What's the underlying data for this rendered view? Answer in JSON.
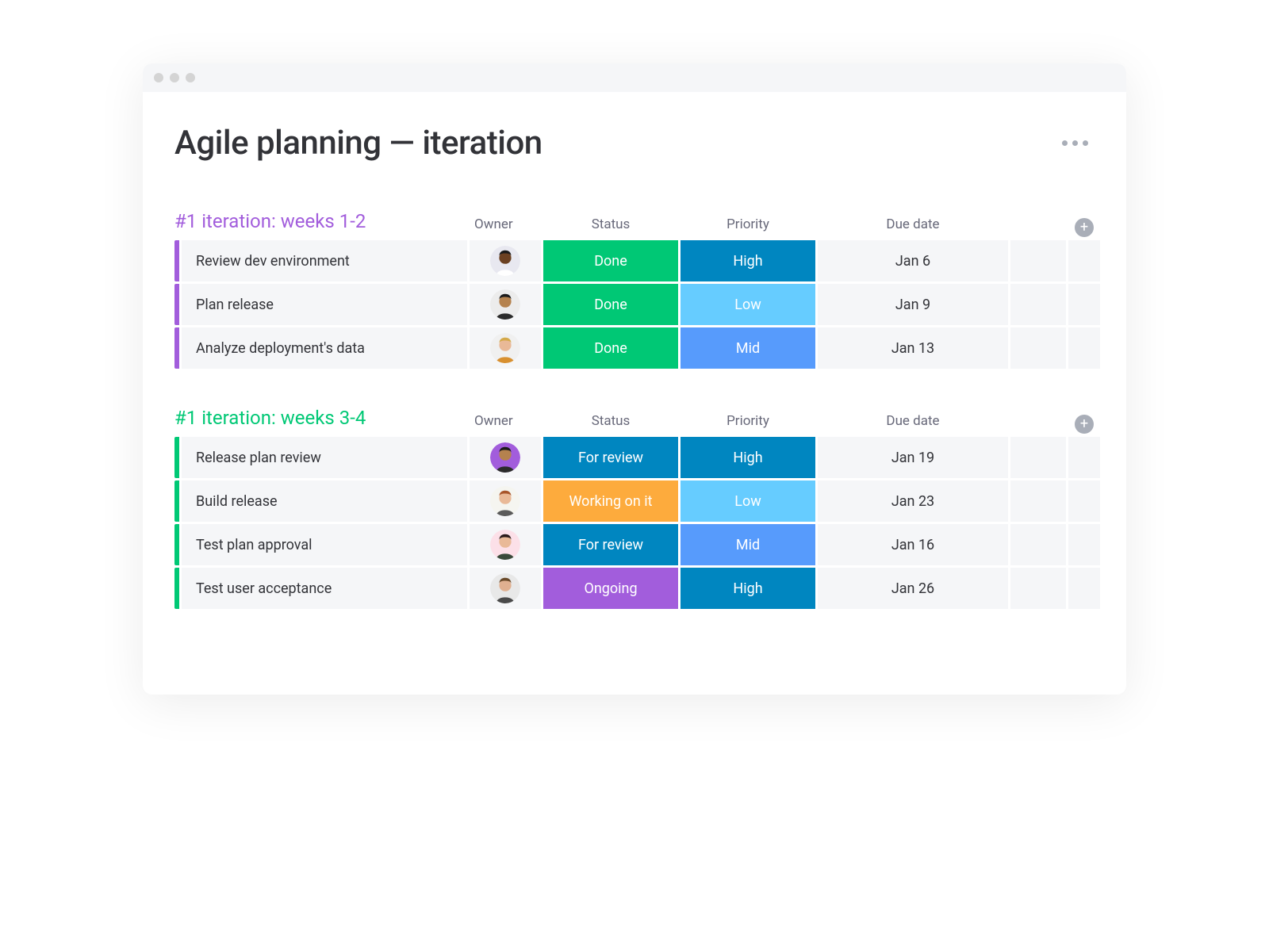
{
  "page": {
    "title": "Agile planning — iteration"
  },
  "columns": {
    "owner": "Owner",
    "status": "Status",
    "priority": "Priority",
    "due_date": "Due date"
  },
  "colors": {
    "purple_accent": "#a25ddc",
    "green_accent": "#00c875",
    "status_done": "#00c875",
    "status_for_review": "#0086c0",
    "status_working": "#fdab3d",
    "status_ongoing": "#a25ddc",
    "priority_high": "#0086c0",
    "priority_mid": "#579bfc",
    "priority_low": "#66ccff"
  },
  "groups": [
    {
      "title": "#1 iteration: weeks 1-2",
      "accent_color": "#a25ddc",
      "rows": [
        {
          "task": "Review dev environment",
          "owner_avatar": {
            "skin": "#6b4021",
            "bg": "#e8e8f0",
            "shirt": "#ffffff",
            "hair": "#1a1a1a"
          },
          "status": {
            "label": "Done",
            "color_key": "status_done"
          },
          "priority": {
            "label": "High",
            "color_key": "priority_high"
          },
          "due_date": "Jan 6"
        },
        {
          "task": "Plan release",
          "owner_avatar": {
            "skin": "#b5824e",
            "bg": "#ececec",
            "shirt": "#2b2b2b",
            "hair": "#1a1a1a"
          },
          "status": {
            "label": "Done",
            "color_key": "status_done"
          },
          "priority": {
            "label": "Low",
            "color_key": "priority_low"
          },
          "due_date": "Jan 9"
        },
        {
          "task": "Analyze deployment's data",
          "owner_avatar": {
            "skin": "#e9b997",
            "bg": "#f0f0f0",
            "shirt": "#d89030",
            "hair": "#d4a94a"
          },
          "status": {
            "label": "Done",
            "color_key": "status_done"
          },
          "priority": {
            "label": "Mid",
            "color_key": "priority_mid"
          },
          "due_date": "Jan 13"
        }
      ]
    },
    {
      "title": "#1 iteration: weeks 3-4",
      "accent_color": "#00c875",
      "rows": [
        {
          "task": "Release plan review",
          "owner_avatar": {
            "skin": "#b5824e",
            "bg": "#a25ddc",
            "shirt": "#2b2b2b",
            "hair": "#1a1a1a"
          },
          "status": {
            "label": "For review",
            "color_key": "status_for_review"
          },
          "priority": {
            "label": "High",
            "color_key": "priority_high"
          },
          "due_date": "Jan 19"
        },
        {
          "task": "Build release",
          "owner_avatar": {
            "skin": "#e9b997",
            "bg": "#f5f5f0",
            "shirt": "#5a5a5a",
            "hair": "#a8552a"
          },
          "status": {
            "label": "Working on it",
            "color_key": "status_working"
          },
          "priority": {
            "label": "Low",
            "color_key": "priority_low"
          },
          "due_date": "Jan 23"
        },
        {
          "task": "Test plan approval",
          "owner_avatar": {
            "skin": "#e9b997",
            "bg": "#fce0e8",
            "shirt": "#3a4a3a",
            "hair": "#2a1a1a"
          },
          "status": {
            "label": "For review",
            "color_key": "status_for_review"
          },
          "priority": {
            "label": "Mid",
            "color_key": "priority_mid"
          },
          "due_date": "Jan 16"
        },
        {
          "task": "Test user acceptance",
          "owner_avatar": {
            "skin": "#e0b090",
            "bg": "#e8e8e8",
            "shirt": "#4a4a4a",
            "hair": "#6a4a2a"
          },
          "status": {
            "label": "Ongoing",
            "color_key": "status_ongoing"
          },
          "priority": {
            "label": "High",
            "color_key": "priority_high"
          },
          "due_date": "Jan 26"
        }
      ]
    }
  ]
}
